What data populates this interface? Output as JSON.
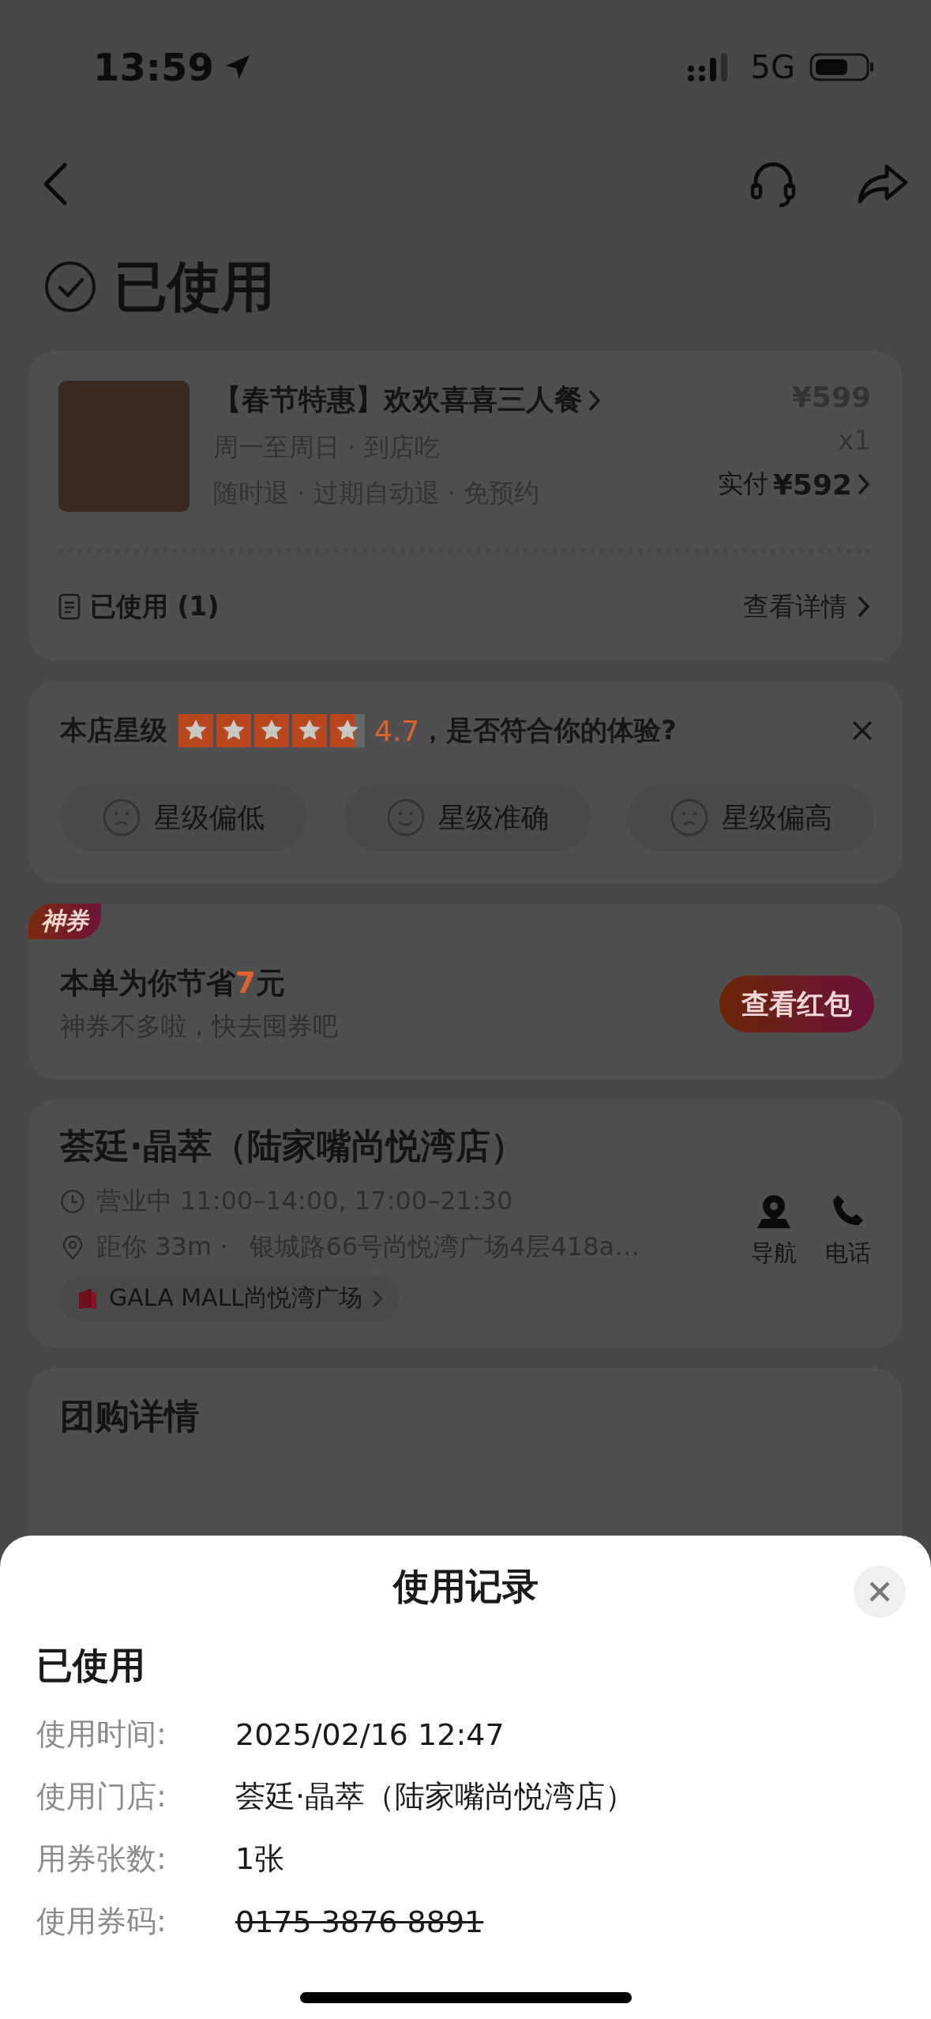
{
  "status_bar": {
    "time": "13:59",
    "network": "5G"
  },
  "order_status": {
    "title": "已使用"
  },
  "order_card": {
    "product_title": "【春节特惠】欢欢喜喜三人餐",
    "original_price": "¥599",
    "quantity": "x1",
    "details_line_1": "周一至周日 · 到店吃",
    "details_line_2": "随时退 · 过期自动退 · 免预约",
    "paid_label": "实付",
    "paid_amount": "¥592",
    "usage_label": "已使用 (1)",
    "view_details": "查看详情"
  },
  "rating_card": {
    "label": "本店星级",
    "stars": 4.7,
    "score": "4.7",
    "question": "，是否符合你的体验?",
    "options": [
      {
        "kind": "frown",
        "label": "星级偏低"
      },
      {
        "kind": "smile",
        "label": "星级准确"
      },
      {
        "kind": "frown",
        "label": "星级偏高"
      }
    ]
  },
  "coupon_card": {
    "badge": "神券",
    "savings_prefix": "本单为你节省",
    "savings_amount": "7",
    "savings_suffix": "元",
    "subtitle": "神券不多啦，快去囤券吧",
    "button": "查看红包"
  },
  "store_card": {
    "name": "荟廷·晶萃（陆家嘴尚悦湾店）",
    "hours": "营业中 11:00–14:00, 17:00–21:30",
    "distance": "距你 33m ·",
    "address": "银城路66号尚悦湾广场4层418a…",
    "mall": "GALA MALL尚悦湾广场",
    "navigate": "导航",
    "call": "电话"
  },
  "group_buy": {
    "title": "团购详情"
  },
  "sheet": {
    "title": "使用记录",
    "status": "已使用",
    "rows": [
      {
        "label": "使用时间:",
        "value": "2025/02/16 12:47",
        "struck": false
      },
      {
        "label": "使用门店:",
        "value": "荟廷·晶萃（陆家嘴尚悦湾店）",
        "struck": false
      },
      {
        "label": "用券张数:",
        "value": "1张",
        "struck": false
      },
      {
        "label": "使用券码:",
        "value": "0175 3876 8891",
        "struck": true
      }
    ]
  }
}
